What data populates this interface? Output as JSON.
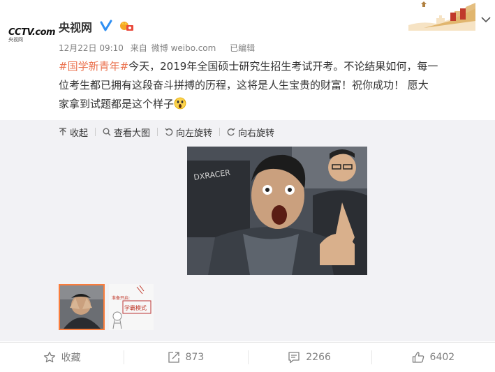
{
  "post": {
    "author": "央视网",
    "avatar_logo": "CCTV.com",
    "avatar_logo_sub": "央视网",
    "date": "12月22日 09:10",
    "source_prefix": "来自",
    "source": "微博 weibo.com",
    "edited": "已编辑",
    "topic": "#国学新青年#",
    "text_line1_rest": "今天，2019年全国硕士研究生招生考试开考。不论结果如何，每一",
    "text_line2": "位考生都已拥有这段奋斗拼搏的历程，这将是人生宝贵的财富！祝你成功！ 愿大",
    "text_line3": "家拿到试题都是这个样子",
    "emoji": "scream-emoji"
  },
  "media_toolbar": {
    "collapse": "收起",
    "view_large": "查看大图",
    "rotate_left": "向左旋转",
    "rotate_right": "向右旋转"
  },
  "thumbnail2_text": {
    "top": "准备开启:",
    "bottom": "学霸模式"
  },
  "footer": {
    "favorite": "收藏",
    "repost_count": "873",
    "comment_count": "2266",
    "like_count": "6402"
  },
  "colors": {
    "topic": "#eb7350",
    "verified": "#2f8ff2",
    "thumb_border": "#fa7d3c"
  }
}
